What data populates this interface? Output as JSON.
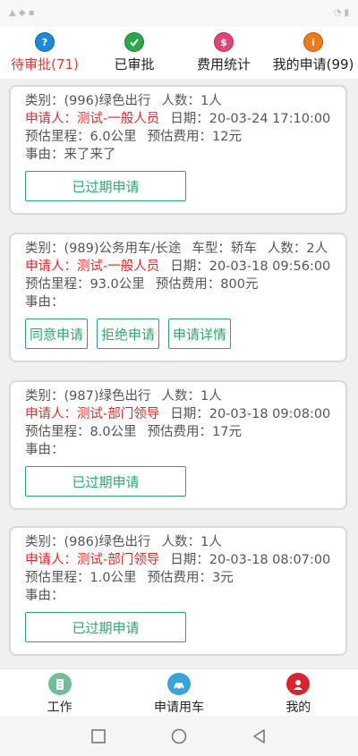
{
  "tabs": [
    {
      "label": "待审批(71)",
      "icon": "question-icon",
      "color": "#1e88d8"
    },
    {
      "label": "已审批",
      "icon": "check-icon",
      "color": "#2aa84a"
    },
    {
      "label": "费用统计",
      "icon": "dollar-icon",
      "color": "#e0457a"
    },
    {
      "label": "我的申请(99)",
      "icon": "info-icon",
      "color": "#ef7a1a"
    }
  ],
  "cards": [
    {
      "category": "类别：(996)绿色出行",
      "people": "人数：1人",
      "applicant": "申请人：测试-一般人员",
      "date": "日期：20-03-24 17:10:00",
      "mileage": "预估里程：6.0公里",
      "cost": "预估费用：12元",
      "reason": "事由：来了来了",
      "buttons": [
        "已过期申请"
      ]
    },
    {
      "category": "类别：(989)公务用车/长途",
      "car_type": "车型：轿车",
      "people": "人数：2人",
      "applicant": "申请人：测试-一般人员",
      "date": "日期：20-03-18 09:56:00",
      "mileage": "预估里程：93.0公里",
      "cost": "预估费用：800元",
      "reason": "事由：",
      "buttons": [
        "同意申请",
        "拒绝申请",
        "申请详情"
      ]
    },
    {
      "category": "类别：(987)绿色出行",
      "people": "人数：1人",
      "applicant": "申请人：测试-部门领导",
      "date": "日期：20-03-18 09:08:00",
      "mileage": "预估里程：8.0公里",
      "cost": "预估费用：17元",
      "reason": "事由：",
      "buttons": [
        "已过期申请"
      ]
    },
    {
      "category": "类别：(986)绿色出行",
      "people": "人数：1人",
      "applicant": "申请人：测试-部门领导",
      "date": "日期：20-03-18 08:07:00",
      "mileage": "预估里程：1.0公里",
      "cost": "预估费用：3元",
      "reason": "事由：",
      "buttons": [
        "已过期申请"
      ]
    }
  ],
  "bottom_nav": [
    {
      "label": "工作",
      "icon": "document-icon",
      "color": "#6fbf9a"
    },
    {
      "label": "申请用车",
      "icon": "car-icon",
      "color": "#3aa3d8"
    },
    {
      "label": "我的",
      "icon": "user-icon",
      "color": "#d8262e"
    }
  ],
  "colors": {
    "accent_green": "#2aa86f",
    "active_red": "#e03a3a",
    "applicant_red": "#e02a2a"
  }
}
